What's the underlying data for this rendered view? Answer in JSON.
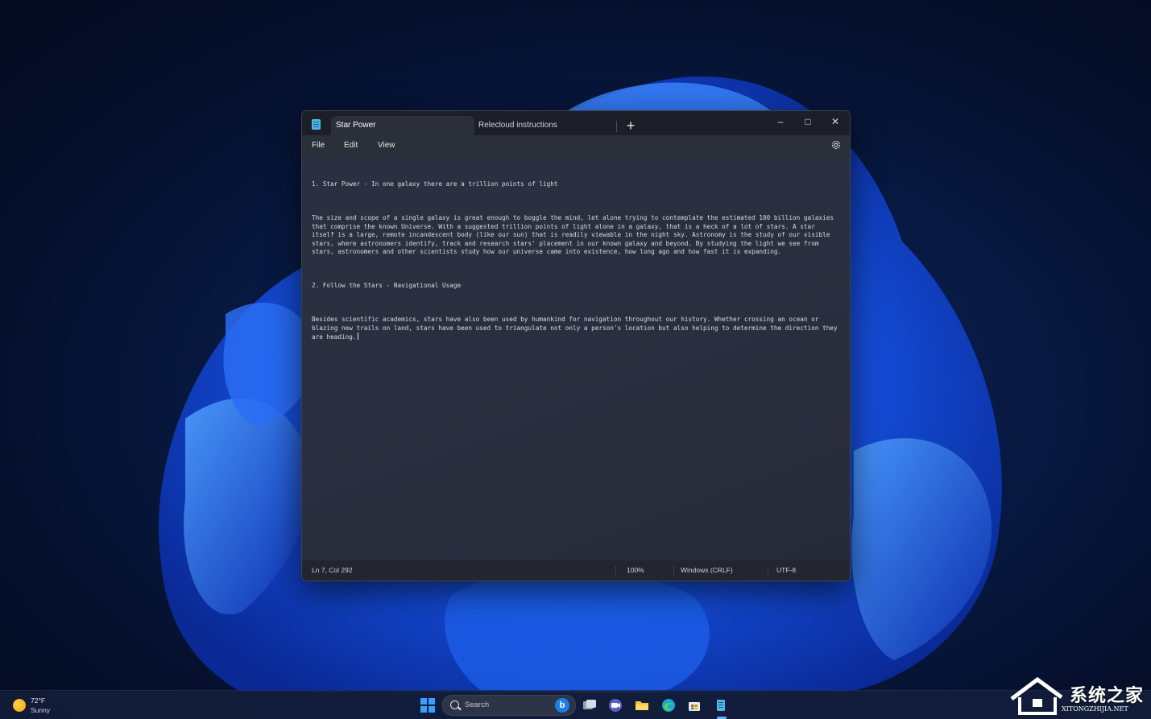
{
  "window": {
    "tabs": [
      {
        "label": "Star Power",
        "active": true
      },
      {
        "label": "Relecloud instructions",
        "active": false
      }
    ],
    "new_tab_glyph": "+",
    "controls": {
      "minimize": "–",
      "maximize": "□",
      "close": "✕"
    }
  },
  "menu": {
    "file": "File",
    "edit": "Edit",
    "view": "View",
    "settings_icon": "gear-icon"
  },
  "editor": {
    "paragraphs": [
      "1. Star Power - In one galaxy there are a trillion points of light",
      "The size and scope of a single galaxy is great enough to boggle the mind, let alone trying to contemplate the estimated 100 billion galaxies that comprise the known Universe. With a suggested trillion points of light alone in a galaxy, that is a heck of a lot of stars. A star itself is a large, remote incandescent body (like our sun) that is readily viewable in the night sky. Astronomy is the study of our visible stars, where astronomers identify, track and research stars' placement in our known galaxy and beyond. By studying the light we see from stars, astronomers and other scientists study how our universe came into existence, how long ago and how fast it is expanding.",
      "2. Follow the Stars - Navigational Usage",
      "Besides scientific academics, stars have also been used by humankind for navigation throughout our history. Whether crossing an ocean or blazing new trails on land, stars have been used to triangulate not only a person's location but also helping to determine the direction they are heading."
    ]
  },
  "status": {
    "position": "Ln 7, Col 292",
    "zoom": "100%",
    "line_ending": "Windows (CRLF)",
    "encoding": "UTF-8"
  },
  "taskbar": {
    "weather_temp": "72°F",
    "weather_condition": "Sunny",
    "search_label": "Search",
    "bing_glyph": "b",
    "apps": [
      "start-icon",
      "task-view-icon",
      "teams-icon",
      "file-explorer-icon",
      "edge-icon",
      "store-icon",
      "notepad-icon"
    ]
  },
  "watermark": {
    "title": "系统之家",
    "url": "XITONGZHIJIA.NET"
  },
  "colors": {
    "accent": "#3aa0ff",
    "window_bg": "#272b36",
    "titlebar_bg": "#1c1f27"
  }
}
